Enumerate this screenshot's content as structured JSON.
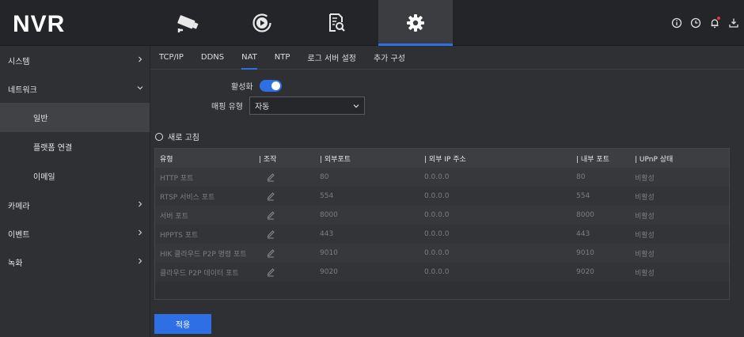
{
  "app": {
    "logo": "NVR"
  },
  "top_tabs": [
    {
      "name": "camera",
      "icon": "camera-icon"
    },
    {
      "name": "playback",
      "icon": "playback-icon"
    },
    {
      "name": "search",
      "icon": "file-search-icon"
    },
    {
      "name": "settings",
      "icon": "gear-icon",
      "active": true
    }
  ],
  "top_right_icons": [
    "info-icon",
    "clock-icon",
    "bell-icon",
    "logout-icon"
  ],
  "sidebar": {
    "items": [
      {
        "label": "시스템",
        "expanded": false
      },
      {
        "label": "네트워크",
        "expanded": true
      },
      {
        "label": "일반",
        "sub": true,
        "active": true
      },
      {
        "label": "플랫폼 연결",
        "sub": true
      },
      {
        "label": "이메일",
        "sub": true
      },
      {
        "label": "카메라",
        "expanded": false
      },
      {
        "label": "이벤트",
        "expanded": false
      },
      {
        "label": "녹화",
        "expanded": false
      }
    ]
  },
  "subtabs": [
    "TCP/IP",
    "DDNS",
    "NAT",
    "NTP",
    "로그 서버 설정",
    "추가 구성"
  ],
  "active_subtab": "NAT",
  "form": {
    "enable_label": "활성화",
    "enable_on": true,
    "mapping_label": "매핑 유형",
    "mapping_value": "자동"
  },
  "refresh_label": "새로 고침",
  "table": {
    "headers": [
      "유형",
      "| 조작",
      "| 외부포트",
      "| 외부 IP 주소",
      "| 내부 포트",
      "| UPnP 상태"
    ],
    "rows": [
      [
        "HTTP 포트",
        "80",
        "0.0.0.0",
        "80",
        "비활성"
      ],
      [
        "RTSP 서비스 포트",
        "554",
        "0.0.0.0",
        "554",
        "비활성"
      ],
      [
        "서버 포트",
        "8000",
        "0.0.0.0",
        "8000",
        "비활성"
      ],
      [
        "HPPTS 포트",
        "443",
        "0.0.0.0",
        "443",
        "비활성"
      ],
      [
        "HIK 클라우드 P2P 명령 포트",
        "9010",
        "0.0.0.0",
        "9010",
        "비활성"
      ],
      [
        "클라우드 P2P 데이터 포트",
        "9020",
        "0.0.0.0",
        "9020",
        "비활성"
      ]
    ]
  },
  "apply_label": "적용",
  "colors": {
    "accent": "#2f6fe5",
    "alert": "#e03b3b"
  }
}
